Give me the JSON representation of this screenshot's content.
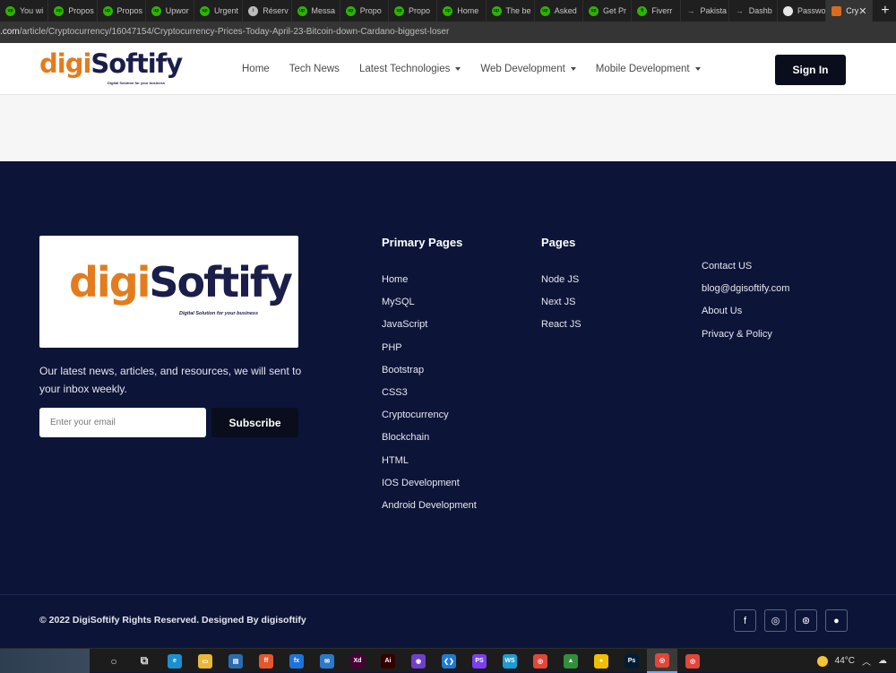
{
  "browser": {
    "tabs": [
      {
        "label": "You wi",
        "icon": "upwork-icon"
      },
      {
        "label": "Propos",
        "icon": "upwork-icon"
      },
      {
        "label": "Propos",
        "icon": "upwork-icon"
      },
      {
        "label": "Upwor",
        "icon": "upwork-icon"
      },
      {
        "label": "Urgent",
        "icon": "upwork-icon"
      },
      {
        "label": "Réserv",
        "icon": "info-icon"
      },
      {
        "label": "Messa",
        "icon": "upwork-icon"
      },
      {
        "label": "Propo",
        "icon": "upwork-icon"
      },
      {
        "label": "Propo",
        "icon": "upwork-icon"
      },
      {
        "label": "Home",
        "icon": "upwork-icon"
      },
      {
        "label": "The be",
        "icon": "upwork-icon"
      },
      {
        "label": "Asked",
        "icon": "upwork-icon"
      },
      {
        "label": "Get Pr",
        "icon": "upwork-icon"
      },
      {
        "label": "Fiverr",
        "icon": "fiverr-icon"
      },
      {
        "label": "Pakista",
        "icon": "arrow-icon"
      },
      {
        "label": "Dashb",
        "icon": "arrow-icon"
      },
      {
        "label": "Passwo",
        "icon": "globe-icon"
      }
    ],
    "active_tab": {
      "label": "Cry",
      "icon": "digisoftify-icon"
    },
    "new_tab": "+",
    "close": "✕",
    "url_host": ".com",
    "url_path": "/article/Cryptocurrency/16047154/Cryptocurrency-Prices-Today-April-23-Bitcoin-down-Cardano-biggest-loser"
  },
  "header": {
    "logo_digi": "digi",
    "logo_softify": "Softify",
    "logo_tagline": "Digital Solution for your business",
    "menu": [
      {
        "label": "Home",
        "dropdown": false
      },
      {
        "label": "Tech News",
        "dropdown": false
      },
      {
        "label": "Latest Technologies",
        "dropdown": true
      },
      {
        "label": "Web Development",
        "dropdown": true
      },
      {
        "label": "Mobile Development",
        "dropdown": true
      }
    ],
    "signin_label": "Sign In"
  },
  "footer": {
    "logo_digi": "digi",
    "logo_softify": "Softify",
    "logo_tagline": "Digital Solution for your business",
    "description": "Our latest news, articles, and resources, we will sent to your inbox weekly.",
    "email_placeholder": "Enter your email",
    "subscribe_label": "Subscribe",
    "primary_pages_title": "Primary Pages",
    "primary_pages": [
      "Home",
      "MySQL",
      "JavaScript",
      "PHP",
      "Bootstrap",
      "CSS3",
      "Cryptocurrency",
      "Blockchain",
      "HTML",
      "IOS Development",
      "Android Development"
    ],
    "pages_title": "Pages",
    "pages": [
      "Node JS",
      "Next JS",
      "React JS"
    ],
    "contact_links": [
      "Contact US",
      "blog@dgisoftify.com",
      "About Us",
      "Privacy & Policy"
    ],
    "copyright": "© 2022 DigiSoftify Rights Reserved. Designed By digisoftify",
    "socials": [
      {
        "name": "facebook-icon",
        "glyph": "f"
      },
      {
        "name": "instagram-icon",
        "glyph": "◎"
      },
      {
        "name": "dribbble-icon",
        "glyph": "⊛"
      },
      {
        "name": "github-icon",
        "glyph": "●"
      }
    ]
  },
  "taskbar": {
    "weather_temp": "44°C",
    "apps": [
      {
        "name": "cortana-icon",
        "glyph": "○",
        "bg": "transparent"
      },
      {
        "name": "task-view-icon",
        "glyph": "⧉",
        "bg": "transparent"
      },
      {
        "name": "edge-icon",
        "glyph": "e",
        "bg": "#1d8fd1"
      },
      {
        "name": "file-explorer-icon",
        "glyph": "▭",
        "bg": "#e8b83a"
      },
      {
        "name": "store-icon",
        "glyph": "▤",
        "bg": "#2b6cb0"
      },
      {
        "name": "firefox-icon",
        "glyph": "ff",
        "bg": "#e4572e"
      },
      {
        "name": "firefox-dev-icon",
        "glyph": "fx",
        "bg": "#1e73d8"
      },
      {
        "name": "mail-icon",
        "glyph": "✉",
        "bg": "#2b79c8"
      },
      {
        "name": "xd-icon",
        "glyph": "Xd",
        "bg": "#470137"
      },
      {
        "name": "illustrator-icon",
        "glyph": "Ai",
        "bg": "#330000"
      },
      {
        "name": "github-desktop-icon",
        "glyph": "◉",
        "bg": "#6e40c9"
      },
      {
        "name": "vscode-icon",
        "glyph": "❮❯",
        "bg": "#1f7ad1"
      },
      {
        "name": "phpstorm-icon",
        "glyph": "PS",
        "bg": "#7b3ff2"
      },
      {
        "name": "webstorm-icon",
        "glyph": "WS",
        "bg": "#1d9bd6"
      },
      {
        "name": "chrome-icon",
        "glyph": "◎",
        "bg": "#e0473b"
      },
      {
        "name": "mongodb-icon",
        "glyph": "▲",
        "bg": "#2f8f3d"
      },
      {
        "name": "sticky-icon",
        "glyph": "●",
        "bg": "#f0c000"
      },
      {
        "name": "photoshop-icon",
        "glyph": "Ps",
        "bg": "#001d34"
      },
      {
        "name": "chrome-active-icon",
        "glyph": "◎",
        "bg": "#e0473b"
      },
      {
        "name": "chrome-profile-icon",
        "glyph": "◎",
        "bg": "#e0473b"
      }
    ]
  }
}
